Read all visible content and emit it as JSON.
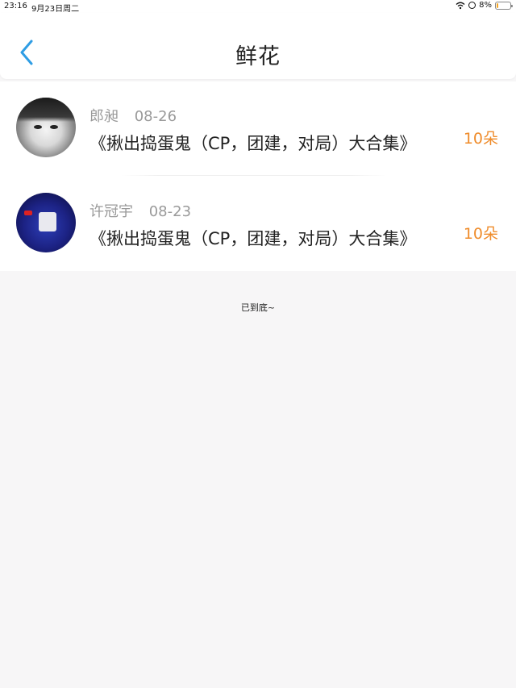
{
  "status_bar": {
    "time": "23:16",
    "date": "9月23日周二",
    "battery_percent": "8%",
    "battery_level": 0.08
  },
  "nav": {
    "title": "鲜花",
    "back_icon": "chevron-left-icon"
  },
  "colors": {
    "accent_blue": "#2f9de4",
    "amount_orange": "#ef8c2b",
    "meta_gray": "#9a9a9a",
    "background": "#f7f6f7"
  },
  "items": [
    {
      "name": "郎昶",
      "date": "08-26",
      "title": "《揪出捣蛋鬼（CP，团建，对局）大合集》",
      "amount": "10朵"
    },
    {
      "name": "许冠宇",
      "date": "08-23",
      "title": "《揪出捣蛋鬼（CP，团建，对局）大合集》",
      "amount": "10朵"
    }
  ],
  "footer": {
    "end_text": "已到底~"
  }
}
